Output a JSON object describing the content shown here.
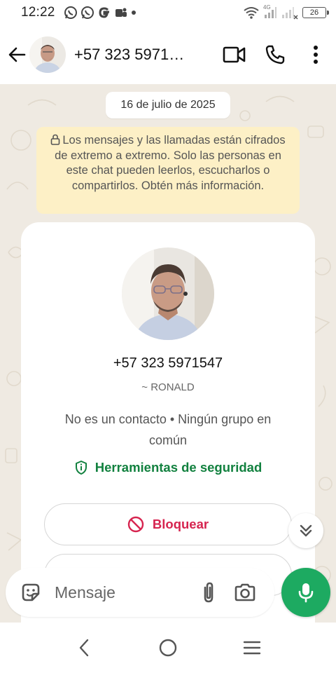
{
  "status_bar": {
    "time": "12:22",
    "network_label": "4G",
    "battery": "26"
  },
  "header": {
    "title": "+57 323 5971…",
    "avatar_icon": "person-avatar",
    "back_icon": "arrow-back-icon",
    "video_icon": "video-call-icon",
    "call_icon": "phone-icon",
    "menu_icon": "more-vert-icon"
  },
  "chat": {
    "date": "16 de julio de 2025",
    "encryption_notice": "Los mensajes y las llamadas están cifrados de extremo a extremo. Solo las personas en este chat pueden leerlos, escucharlos o compartirlos. Obtén más información."
  },
  "profile_card": {
    "phone": "+57 323 5971547",
    "name": "~ RONALD",
    "info": "No es un contacto • Ningún grupo en común",
    "security_label": "Herramientas de seguridad",
    "block_label": "Bloquear"
  },
  "composer": {
    "placeholder": "Mensaje"
  },
  "colors": {
    "brand_green": "#1daa61",
    "security_green": "#12813f",
    "block_red": "#d6244f",
    "chat_background": "#efeae2",
    "notice_background": "#fdf0c6"
  }
}
